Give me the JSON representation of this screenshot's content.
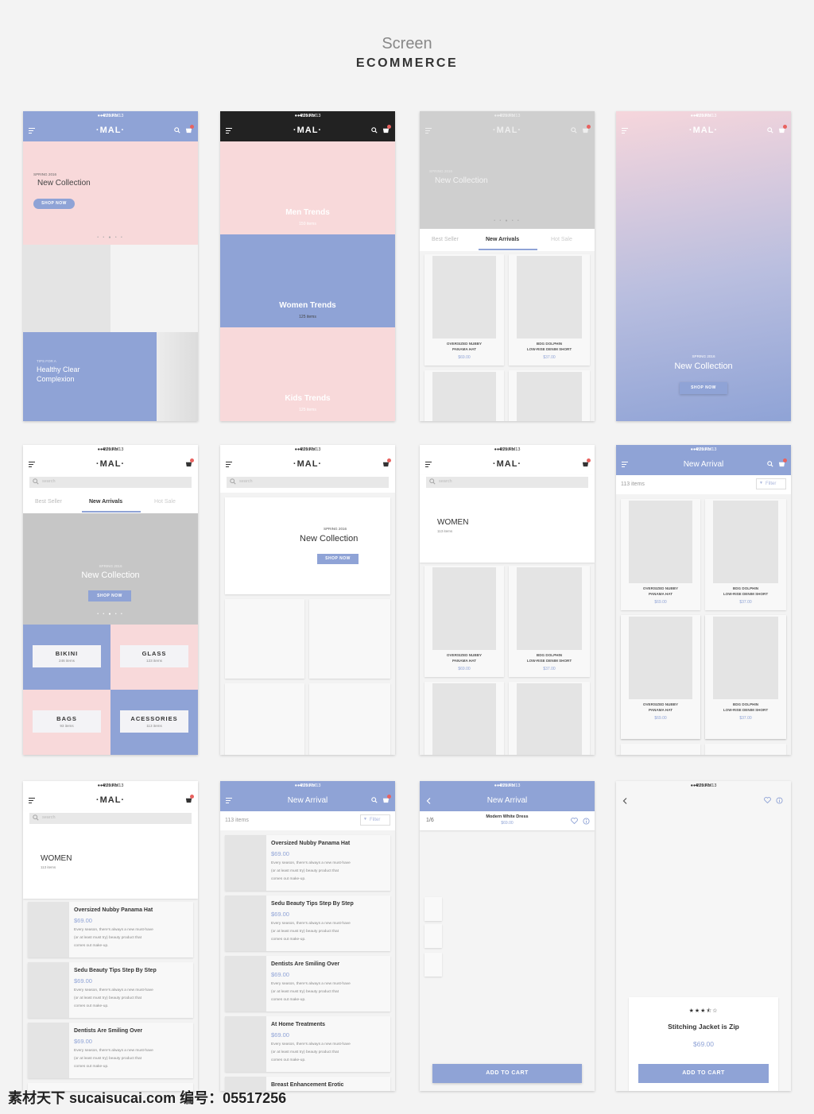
{
  "header": {
    "title": "Screen",
    "subtitle": "ECOMMERCE"
  },
  "status": {
    "carrier": "●●●○○ No.13",
    "time": "4:21 PM",
    "battery": "22%"
  },
  "brand": "·MAL·",
  "colors": {
    "accent": "#8fa3d6",
    "pink": "#f8d9da",
    "dark": "#222222",
    "badge": "#e8625f",
    "hero_gray": "#c8c8c8"
  },
  "hero": {
    "kicker": "SPRING 2016",
    "title": "New Collection",
    "shop_now": "SHOP NOW"
  },
  "tips": {
    "kicker": "TIPS FOR A",
    "title_line1": "Healthy Clear",
    "title_line2": "Complexion"
  },
  "trends": [
    {
      "name": "Men Trends",
      "count": "150 items"
    },
    {
      "name": "Women Trends",
      "count": "125 items"
    },
    {
      "name": "Kids Trends",
      "count": "125 items"
    }
  ],
  "tabs": [
    "Best Seller",
    "New Arrivals",
    "Hot Sale"
  ],
  "search_placeholder": "search",
  "products": [
    {
      "name1": "OVERSIZED NUBBY",
      "name2": "PANAMA HAT",
      "price": "$69.00"
    },
    {
      "name1": "BDG DOLPHIN",
      "name2": "LOW-RISE DENIM SHORT",
      "price": "$37.00"
    }
  ],
  "categories": [
    {
      "name": "BIKINI",
      "count": "246 items"
    },
    {
      "name": "GLASS",
      "count": "123 items"
    },
    {
      "name": "BAGS",
      "count": "93 items"
    },
    {
      "name": "ACESSORIES",
      "count": "113 items"
    }
  ],
  "women": {
    "title": "WOMEN",
    "count": "113 items"
  },
  "listing": {
    "title": "New Arrival",
    "count": "113 items",
    "filter": "Filter"
  },
  "articles": [
    {
      "title": "Oversized Nubby Panama Hat",
      "price": "$69.00",
      "d1": "Every season, there's always a new must-have",
      "d2": "(or at least must try) beauty product that",
      "d3": "comes out make-up."
    },
    {
      "title": "Sedu Beauty Tips Step By Step",
      "price": "$69.00",
      "d1": "Every season, there's always a new must-have",
      "d2": "(or at least must try) beauty product that",
      "d3": "comes out make-up."
    },
    {
      "title": "Dentists Are Smiling Over",
      "price": "$69.00",
      "d1": "Every season, there's always a new must-have",
      "d2": "(or at least must try) beauty product that",
      "d3": "comes out make-up."
    },
    {
      "title": "At Home Treatments",
      "price": "$69.00",
      "d1": "Every season, there's always a new must-have",
      "d2": "(or at least must try) beauty product that",
      "d3": "comes out make-up."
    },
    {
      "title": "Breast Enhancement Erotic"
    }
  ],
  "detail": {
    "pager": "1/6",
    "name": "Modern White Dress",
    "price": "$69.00",
    "add_to_cart": "ADD TO CART"
  },
  "detail2": {
    "rating": 3.5,
    "stars": "★★★⯪☆",
    "name": "Stitching Jacket is Zip",
    "price": "$69.00",
    "add_to_cart": "ADD TO CART"
  },
  "watermark": "素材天下 sucaisucai.com  编号：05517256"
}
